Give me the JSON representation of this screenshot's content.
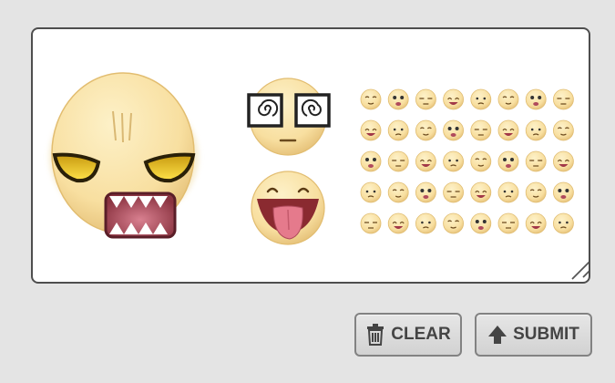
{
  "canvas": {
    "large_emoticons": [
      "bored-face-with-fangs",
      "dizzy-spiral-eyes-face",
      "tongue-out-face"
    ],
    "small_emoticon_grid": {
      "rows": 5,
      "columns": 8
    }
  },
  "actions": {
    "clear_label": "CLEAR",
    "clear_icon": "trash-icon",
    "submit_label": "SUBMIT",
    "submit_icon": "up-arrow-icon"
  },
  "colors": {
    "background": "#e4e4e4",
    "panel": "#ffffff",
    "panel_border": "#4e4e4e",
    "face": "#f8e0a2",
    "button_text": "#444444"
  }
}
